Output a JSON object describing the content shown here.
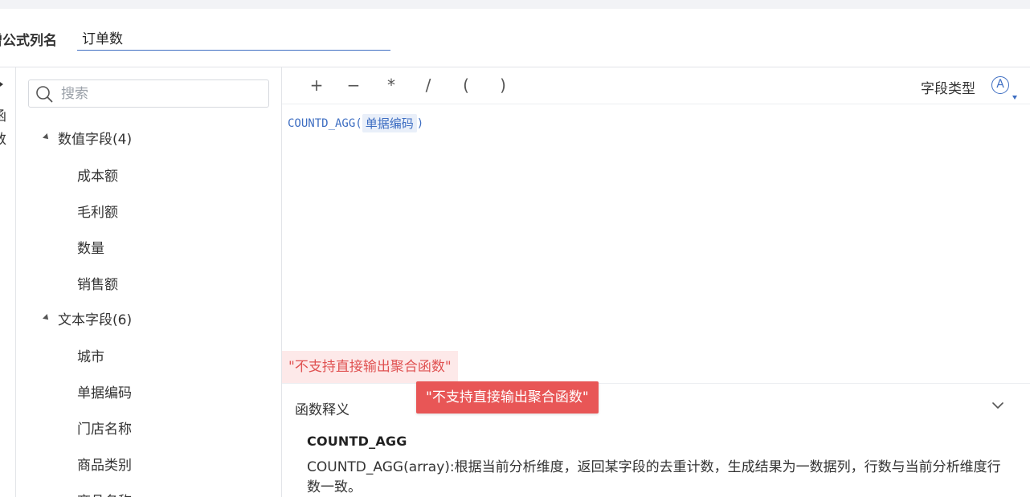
{
  "header": {
    "name_label": "增公式列名",
    "name_value": "订单数"
  },
  "left_rail": {
    "text_items": [
      "函",
      "数"
    ]
  },
  "field_panel": {
    "search_placeholder": "搜索",
    "groups": [
      {
        "label": "数值字段(4)",
        "items": [
          "成本额",
          "毛利额",
          "数量",
          "销售额"
        ]
      },
      {
        "label": "文本字段(6)",
        "items": [
          "城市",
          "单据编码",
          "门店名称",
          "商品类别",
          "商品名称"
        ]
      }
    ]
  },
  "toolbar": {
    "operators": [
      "+",
      "−",
      "*",
      "/",
      "(",
      ")"
    ],
    "field_type_label": "字段类型",
    "field_type_icon": "A"
  },
  "editor": {
    "function_name": "COUNTD_AGG",
    "open_paren": "(",
    "field_token": "单据编码",
    "close_paren": ")"
  },
  "error": {
    "inline_message": "\"不支持直接输出聚合函数\"",
    "tooltip_message": "\"不支持直接输出聚合函数\""
  },
  "explain": {
    "title": "函数释义",
    "function_name": "COUNTD_AGG",
    "description": "COUNTD_AGG(array):根据当前分析维度，返回某字段的去重计数，生成结果为一数据列，行数与当前分析维度行数一致。"
  },
  "colors": {
    "accent": "#3e6ec2",
    "error_bg": "#fde9e9",
    "error_text": "#e05252",
    "tooltip_bg": "#e85656"
  }
}
